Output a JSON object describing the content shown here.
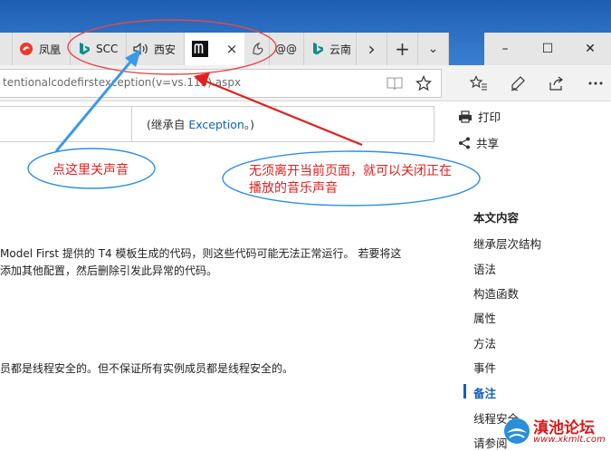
{
  "tabs": [
    {
      "label": "凤凰",
      "icon": "fenghuang-icon"
    },
    {
      "label": "SCC",
      "icon": "bing-icon"
    },
    {
      "label": "西安",
      "icon": "speaker-icon"
    },
    {
      "label": "",
      "icon": "m-logo-icon",
      "close": "×"
    },
    {
      "label": "",
      "icon": "fox-icon"
    },
    {
      "label": "@@",
      "icon": ""
    },
    {
      "label": "云南",
      "icon": "bing-icon"
    }
  ],
  "tab_controls": {
    "scroll_right": "›",
    "new_tab": "+",
    "tab_list": "⌄"
  },
  "window_controls": {
    "minimize": "–",
    "maximize": "☐",
    "close": "✕"
  },
  "address": {
    "url": "tentionalcodefirstexception(v=vs.113).aspx"
  },
  "content": {
    "inherit_prefix": "(继承自 ",
    "inherit_link": "Exception",
    "inherit_suffix": "。)",
    "para1_line1": "Model First 提供的 T4 模板生成的代码，则这些代码可能无法正常运行。 若要将这",
    "para1_line2": "添加其他配置，然后删除引发此异常的代码。",
    "para2": "员都是线程安全的。但不保证所有实例成员都是线程安全的。"
  },
  "sidebar": {
    "print": "打印",
    "share": "共享",
    "toc_title": "本文内容",
    "toc_items": [
      "继承层次结构",
      "语法",
      "构造函数",
      "属性",
      "方法",
      "事件",
      "备注",
      "线程安全",
      "请参阅"
    ],
    "active_index": 6
  },
  "annotations": {
    "left_callout": "点这里关声音",
    "right_callout_line1": "无须离开当前页面，就可以关闭正在",
    "right_callout_line2": "播放的音乐声音"
  },
  "watermark": {
    "title": "滇池论坛",
    "url": "www.xkmlt.com"
  },
  "colors": {
    "accent": "#1560b8",
    "annotation_red": "#e02020",
    "annotation_blue": "#2f8fe0"
  }
}
